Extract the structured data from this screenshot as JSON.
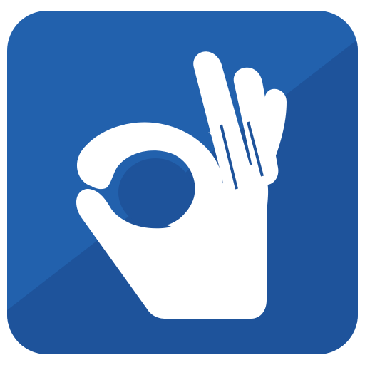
{
  "icon": {
    "name": "ok-hand-gesture-icon",
    "colors": {
      "tile_light": "#2261ad",
      "tile_dark": "#1e539b",
      "glyph": "#ffffff"
    }
  }
}
